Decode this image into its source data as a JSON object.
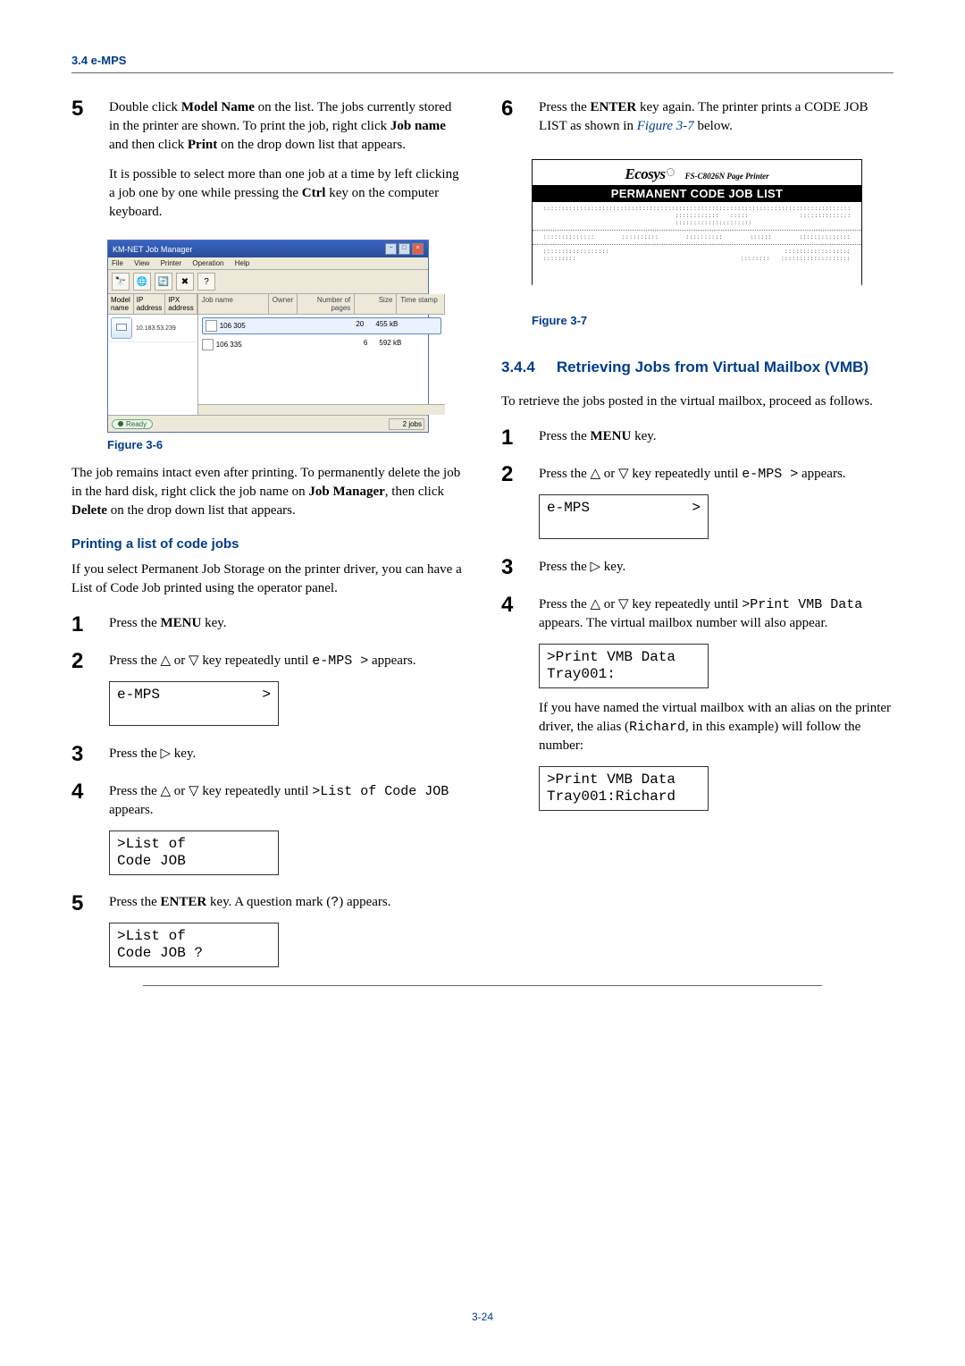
{
  "header": {
    "section_ref": "3.4 e-MPS"
  },
  "footer": {
    "page_number": "3-24"
  },
  "left": {
    "step5": {
      "num": "5",
      "p1_a": "Double click ",
      "p1_bold1": "Model Name",
      "p1_b": " on the list. The jobs currently stored in the printer are shown. To print the job, right click ",
      "p1_bold2": "Job name",
      "p1_c": " and then click ",
      "p1_bold3": "Print",
      "p1_d": " on the drop down list that appears.",
      "p2_a": "It is possible to select more than one job at a time by left clicking a job one by one while pressing the ",
      "p2_bold1": "Ctrl",
      "p2_b": " key on the computer keyboard."
    },
    "fig36": {
      "title": "KM-NET Job Manager",
      "menus": [
        "File",
        "View",
        "Printer",
        "Operation",
        "Help"
      ],
      "toolbar_icons": [
        "binoculars-icon",
        "globe-icon",
        "refresh-icon",
        "delete-icon",
        "help-icon"
      ],
      "left_cols": [
        " Model name ",
        " IP address ",
        " IPX address "
      ],
      "row_ip": "10.183.53.239",
      "right_cols": [
        "Job name",
        "Owner",
        "Number of pages",
        "Size",
        "Time stamp"
      ],
      "rows": [
        {
          "name": "106 305",
          "pages": "20",
          "size": "455 kB"
        },
        {
          "name": "106 335",
          "pages": "6",
          "size": "592 kB"
        }
      ],
      "status_ready": "Ready",
      "status_jobs": "2 jobs",
      "win_btns": [
        "−",
        "□",
        "×"
      ],
      "caption": "Figure 3-6"
    },
    "after_fig": {
      "a": "The job remains intact even after printing. To permanently delete the job in the hard disk, right click the job name on ",
      "b1": "Job Manager",
      "c": ", then click ",
      "b2": "Delete",
      "d": " on the drop down list that appears."
    },
    "codejobs": {
      "heading": "Printing a list of code jobs",
      "intro": "If you select Permanent Job Storage on the printer driver, you can have a List of Code Job printed using the operator panel.",
      "s1": {
        "num": "1",
        "a": "Press the ",
        "bold": "MENU",
        "b": " key."
      },
      "s2": {
        "num": "2",
        "a": "Press the ",
        "tri1": "△",
        "mid": " or ",
        "tri2": "▽",
        "b": " key repeatedly until ",
        "mono": "e-MPS  >",
        "c": " appears.",
        "lcd_l1_left": "e-MPS",
        "lcd_l1_right": ">"
      },
      "s3": {
        "num": "3",
        "a": "Press the ",
        "tri": "▷",
        "b": " key."
      },
      "s4": {
        "num": "4",
        "a": "Press the ",
        "tri1": "△",
        "mid": " or ",
        "tri2": "▽",
        "b": " key repeatedly until ",
        "mono": ">List of Code JOB",
        "c": " appears.",
        "lcd_l1": ">List of",
        "lcd_l2": " Code JOB"
      },
      "s5": {
        "num": "5",
        "a": "Press the ",
        "bold": "ENTER",
        "b": " key. A question mark (",
        "mono": "?",
        "c": ") appears.",
        "lcd_l1": ">List of",
        "lcd_l2": " Code JOB ?"
      }
    }
  },
  "right": {
    "step6": {
      "num": "6",
      "a": "Press the ",
      "bold": "ENTER",
      "b": " key again. The printer prints a CODE JOB LIST as shown in ",
      "linkref": "Figure 3-7",
      "c": " below."
    },
    "printout": {
      "brand": "Ecosys",
      "model": "FS-C8026N  Page Printer",
      "bar": "PERMANENT CODE JOB LIST"
    },
    "fig37_caption": "Figure 3-7",
    "section344": {
      "num": "3.4.4",
      "title": "Retrieving Jobs from Virtual Mailbox (VMB)"
    },
    "intro": "To retrieve the jobs posted in the virtual mailbox, proceed as follows.",
    "s1": {
      "num": "1",
      "a": "Press the ",
      "bold": "MENU",
      "b": " key."
    },
    "s2": {
      "num": "2",
      "a": "Press the ",
      "tri1": "△",
      "mid": " or ",
      "tri2": "▽",
      "b": " key repeatedly until ",
      "mono": "e-MPS  >",
      "c": " appears.",
      "lcd_l1_left": "e-MPS",
      "lcd_l1_right": ">"
    },
    "s3": {
      "num": "3",
      "a": "Press the ",
      "tri": "▷",
      "b": " key."
    },
    "s4": {
      "num": "4",
      "a": "Press the ",
      "tri1": "△",
      "mid": " or ",
      "tri2": "▽",
      "b": " key repeatedly until ",
      "mono": ">Print VMB Data",
      "c": " appears. The virtual mailbox number will also appear.",
      "lcd_l1": ">Print VMB Data",
      "lcd_l2": "Tray001:"
    },
    "alias_para_a": "If you have named the virtual mailbox with an alias on the printer driver, the alias (",
    "alias_mono": "Richard",
    "alias_para_b": ", in this example) will follow the number:",
    "lcd_alias_l1": ">Print VMB Data",
    "lcd_alias_l2": "Tray001:Richard"
  }
}
